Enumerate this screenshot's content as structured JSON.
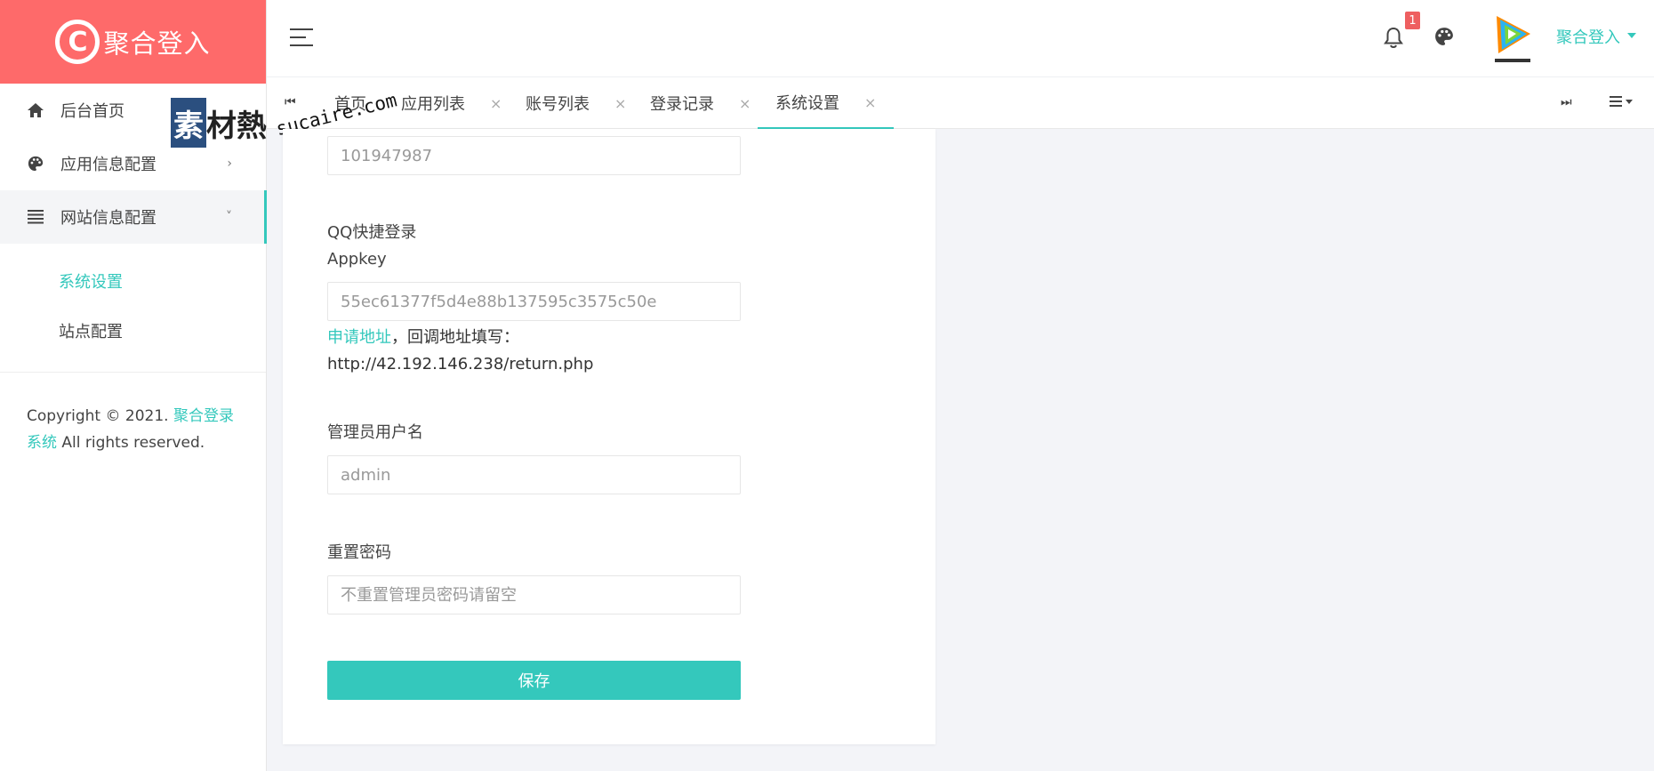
{
  "brand": {
    "title": "聚合登入",
    "logo_glyph": "C",
    "background": "#fe6a6a"
  },
  "accent_color": "#34c8bc",
  "sidebar": {
    "items": [
      {
        "label": "后台首页",
        "icon": "home-icon",
        "arrow": ""
      },
      {
        "label": "应用信息配置",
        "icon": "palette-icon",
        "arrow": "›"
      },
      {
        "label": "网站信息配置",
        "icon": "list-icon",
        "arrow": "˅"
      }
    ],
    "subitems": [
      {
        "label": "系统设置",
        "current": true
      },
      {
        "label": "站点配置",
        "current": false
      }
    ],
    "copyright": {
      "prefix": "Copyright © 2021.",
      "link": "聚合登录系统",
      "suffix": "All rights reserved."
    }
  },
  "watermark": {
    "box_char": "素",
    "chars": "材熱",
    "url": "sucaire.com"
  },
  "header": {
    "notification_count": "1",
    "user_name": "聚合登入",
    "avatar_icon": "tencent-video-logo"
  },
  "tabs": {
    "items": [
      {
        "label": "首页"
      },
      {
        "label": "应用列表",
        "close": "×"
      },
      {
        "label": "账号列表",
        "close": "×"
      },
      {
        "label": "登录记录",
        "close": "×"
      },
      {
        "label": "系统设置",
        "close": "×",
        "active": true
      }
    ],
    "nav_left": "⏮",
    "nav_right": "⏭"
  },
  "form": {
    "appid_value": "101947987",
    "appkey_label_line1": "QQ快捷登录",
    "appkey_label_line2": "Appkey",
    "appkey_value": "55ec61377f5d4e88b137595c3575c50e",
    "apply_link": "申请地址",
    "callback_text": "，回调地址填写：",
    "callback_url": "http://42.192.146.238/return.php",
    "admin_label": "管理员用户名",
    "admin_value": "admin",
    "password_label": "重置密码",
    "password_placeholder": "不重置管理员密码请留空",
    "save_label": "保存"
  }
}
